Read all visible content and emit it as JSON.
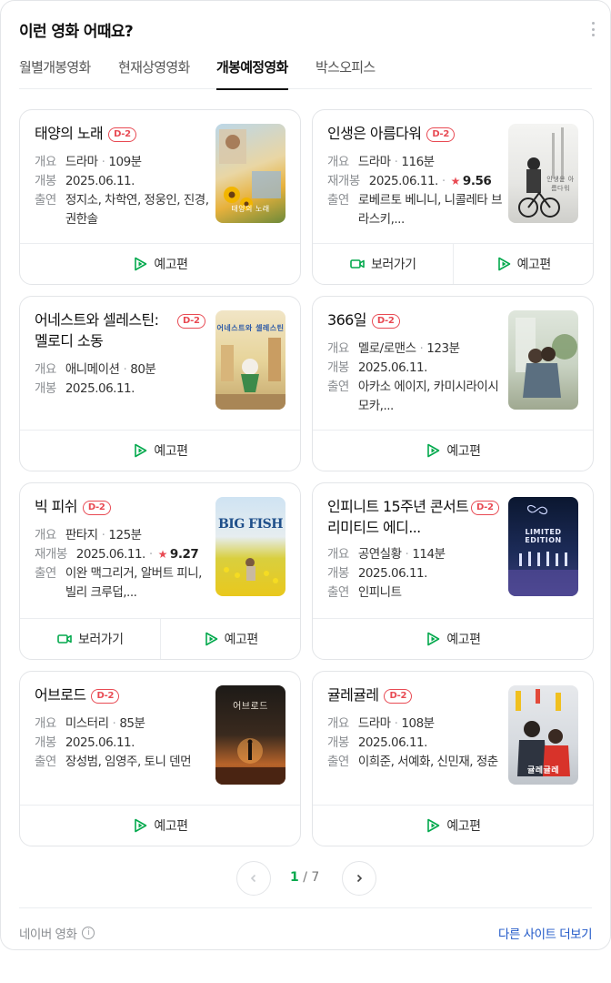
{
  "section": {
    "title": "이런 영화 어때요?",
    "tabs": [
      "월별개봉영화",
      "현재상영영화",
      "개봉예정영화",
      "박스오피스"
    ],
    "active_tab": "개봉예정영화"
  },
  "movies": [
    {
      "title": "태양의 노래",
      "badge": "D-2",
      "genre": "드라마",
      "runtime": "109분",
      "release_label": "개봉",
      "release_date": "2025.06.11.",
      "cast": "정지소, 차학연, 정웅인, 진경, 권한솔",
      "actions": [
        "예고편"
      ],
      "poster_text": "태양의 노래"
    },
    {
      "title": "인생은 아름다워",
      "badge": "D-2",
      "genre": "드라마",
      "runtime": "116분",
      "release_label": "재개봉",
      "release_date": "2025.06.11.",
      "rating": "9.56",
      "cast": "로베르토 베니니, 니콜레타 브라스키,...",
      "actions": [
        "보러가기",
        "예고편"
      ],
      "poster_text": "인생은 아름다워"
    },
    {
      "title": "어네스트와 셀레스틴: 멜로디 소동",
      "badge": "D-2",
      "genre": "애니메이션",
      "runtime": "80분",
      "release_label": "개봉",
      "release_date": "2025.06.11.",
      "actions": [
        "예고편"
      ],
      "poster_text": "어네스트와 셀레스틴"
    },
    {
      "title": "366일",
      "badge": "D-2",
      "genre": "멜로/로맨스",
      "runtime": "123분",
      "release_label": "개봉",
      "release_date": "2025.06.11.",
      "cast": "아카소 에이지, 카미시라이시 모카,...",
      "actions": [
        "예고편"
      ],
      "poster_text": ""
    },
    {
      "title": "빅 피쉬",
      "badge": "D-2",
      "genre": "판타지",
      "runtime": "125분",
      "release_label": "재개봉",
      "release_date": "2025.06.11.",
      "rating": "9.27",
      "cast": "이완 맥그리거, 알버트 피니, 빌리 크루덥,...",
      "actions": [
        "보러가기",
        "예고편"
      ],
      "poster_text": "BIG FISH"
    },
    {
      "title": "인피니트 15주년 콘서트 리미티드 에디...",
      "badge": "D-2",
      "genre": "공연실황",
      "runtime": "114분",
      "release_label": "개봉",
      "release_date": "2025.06.11.",
      "cast": "인피니트",
      "actions": [
        "예고편"
      ],
      "poster_text": "LIMITED EDITION"
    },
    {
      "title": "어브로드",
      "badge": "D-2",
      "genre": "미스터리",
      "runtime": "85분",
      "release_label": "개봉",
      "release_date": "2025.06.11.",
      "cast": "장성범, 임영주, 토니 덴먼",
      "actions": [
        "예고편"
      ],
      "poster_text": "어브로드"
    },
    {
      "title": "귤레귤레",
      "badge": "D-2",
      "genre": "드라마",
      "runtime": "108분",
      "release_label": "개봉",
      "release_date": "2025.06.11.",
      "cast": "이희준, 서예화, 신민재, 정춘",
      "actions": [
        "예고편"
      ],
      "poster_text": "귤레귤레"
    }
  ],
  "labels": {
    "genre": "개요",
    "cast": "출연"
  },
  "pagination": {
    "current": "1",
    "separator": "/",
    "total": "7"
  },
  "footer": {
    "source": "네이버 영화",
    "more": "다른 사이트 더보기"
  },
  "colors": {
    "accent_green": "#03a94d",
    "badge_red": "#e84a53",
    "link_blue": "#2159c8"
  }
}
